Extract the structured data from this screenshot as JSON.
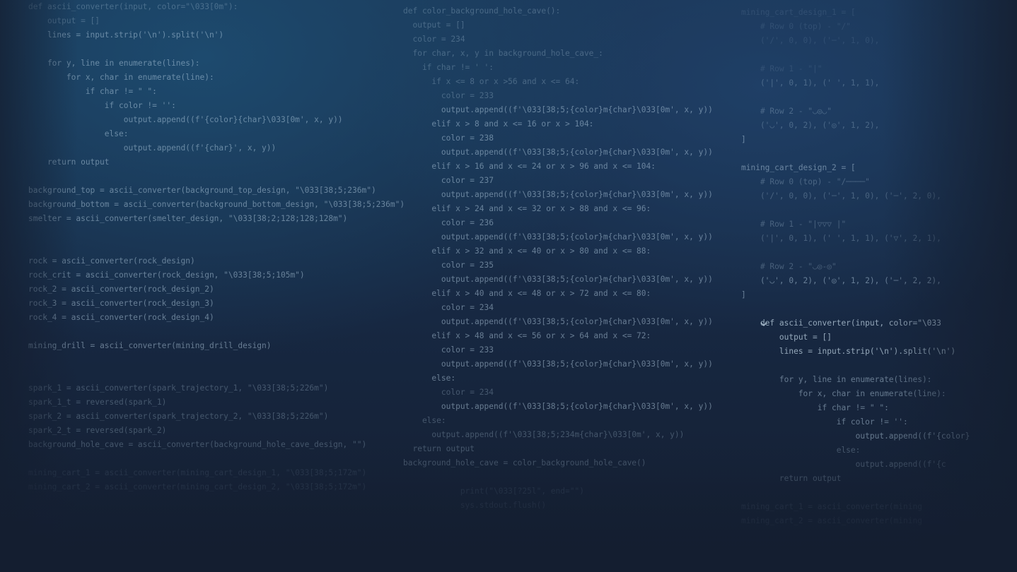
{
  "columns": [
    {
      "id": "left",
      "lines": [
        {
          "t": "def ascii_converter(input, color=\"\\033[0m\"):",
          "o": 1
        },
        {
          "t": "    output = []",
          "o": 1
        },
        {
          "t": "    lines = input.strip('\\n').split('\\n')",
          "o": 2
        },
        {
          "t": "",
          "o": 0
        },
        {
          "t": "    for y, line in enumerate(lines):",
          "o": 2
        },
        {
          "t": "        for x, char in enumerate(line):",
          "o": 2
        },
        {
          "t": "            if char != \" \":",
          "o": 2
        },
        {
          "t": "                if color != '':",
          "o": 2
        },
        {
          "t": "                    output.append((f'{color}{char}\\033[0m', x, y))",
          "o": 2
        },
        {
          "t": "                else:",
          "o": 2
        },
        {
          "t": "                    output.append((f'{char}', x, y))",
          "o": 2
        },
        {
          "t": "    return output",
          "o": 2
        },
        {
          "t": "",
          "o": 0
        },
        {
          "t": "background_top = ascii_converter(background_top_design, \"\\033[38;5;236m\")",
          "o": 2
        },
        {
          "t": "background_bottom = ascii_converter(background_bottom_design, \"\\033[38;5;236m\")",
          "o": 2
        },
        {
          "t": "smelter = ascii_converter(smelter_design, \"\\033[38;2;128;128;128m\")",
          "o": 2
        },
        {
          "t": "",
          "o": 0
        },
        {
          "t": "",
          "o": 0
        },
        {
          "t": "rock = ascii_converter(rock_design)",
          "o": 2
        },
        {
          "t": "rock_crit = ascii_converter(rock_design, \"\\033[38;5;105m\")",
          "o": 2
        },
        {
          "t": "rock_2 = ascii_converter(rock_design_2)",
          "o": 2
        },
        {
          "t": "rock_3 = ascii_converter(rock_design_3)",
          "o": 2
        },
        {
          "t": "rock_4 = ascii_converter(rock_design_4)",
          "o": 2
        },
        {
          "t": "",
          "o": 0
        },
        {
          "t": "mining_drill = ascii_converter(mining_drill_design)",
          "o": 2
        },
        {
          "t": "",
          "o": 0
        },
        {
          "t": "",
          "o": 0
        },
        {
          "t": "spark_1 = ascii_converter(spark_trajectory_1, \"\\033[38;5;226m\")",
          "o": 1
        },
        {
          "t": "spark_1_t = reversed(spark_1)",
          "o": 1
        },
        {
          "t": "spark_2 = ascii_converter(spark_trajectory_2, \"\\033[38;5;226m\")",
          "o": 1
        },
        {
          "t": "spark_2_t = reversed(spark_2)",
          "o": 1
        },
        {
          "t": "background_hole_cave = ascii_converter(background_hole_cave_design, \"\")",
          "o": 1
        },
        {
          "t": "",
          "o": 0
        },
        {
          "t": "mining_cart_1 = ascii_converter(mining_cart_design_1, \"\\033[38;5;172m\")",
          "o": 0
        },
        {
          "t": "mining_cart_2 = ascii_converter(mining_cart_design_2, \"\\033[38;5;172m\")",
          "o": 0
        }
      ]
    },
    {
      "id": "mid",
      "lines": [
        {
          "t": "def color_background_hole_cave():",
          "o": 1
        },
        {
          "t": "  output = []",
          "o": 1
        },
        {
          "t": "  color = 234",
          "o": 1
        },
        {
          "t": "  for char, x, y in background_hole_cave_:",
          "o": 1
        },
        {
          "t": "    if char != ' ':",
          "o": 1
        },
        {
          "t": "      if x <= 8 or x >56 and x <= 64:",
          "o": 1
        },
        {
          "t": "        color = 233",
          "o": 1
        },
        {
          "t": "        output.append((f'\\033[38;5;{color}m{char}\\033[0m', x, y))",
          "o": 2
        },
        {
          "t": "      elif x > 8 and x <= 16 or x > 104:",
          "o": 2
        },
        {
          "t": "        color = 238",
          "o": 2
        },
        {
          "t": "        output.append((f'\\033[38;5;{color}m{char}\\033[0m', x, y))",
          "o": 2
        },
        {
          "t": "      elif x > 16 and x <= 24 or x > 96 and x <= 104:",
          "o": 2
        },
        {
          "t": "        color = 237",
          "o": 2
        },
        {
          "t": "        output.append((f'\\033[38;5;{color}m{char}\\033[0m', x, y))",
          "o": 2
        },
        {
          "t": "      elif x > 24 and x <= 32 or x > 88 and x <= 96:",
          "o": 2
        },
        {
          "t": "        color = 236",
          "o": 2
        },
        {
          "t": "        output.append((f'\\033[38;5;{color}m{char}\\033[0m', x, y))",
          "o": 2
        },
        {
          "t": "      elif x > 32 and x <= 40 or x > 80 and x <= 88:",
          "o": 2
        },
        {
          "t": "        color = 235",
          "o": 2
        },
        {
          "t": "        output.append((f'\\033[38;5;{color}m{char}\\033[0m', x, y))",
          "o": 2
        },
        {
          "t": "      elif x > 40 and x <= 48 or x > 72 and x <= 80:",
          "o": 2
        },
        {
          "t": "        color = 234",
          "o": 2
        },
        {
          "t": "        output.append((f'\\033[38;5;{color}m{char}\\033[0m', x, y))",
          "o": 2
        },
        {
          "t": "      elif x > 48 and x <= 56 or x > 64 and x <= 72:",
          "o": 2
        },
        {
          "t": "        color = 233",
          "o": 2
        },
        {
          "t": "        output.append((f'\\033[38;5;{color}m{char}\\033[0m', x, y))",
          "o": 2
        },
        {
          "t": "      else:",
          "o": 2
        },
        {
          "t": "        color = 234",
          "o": 1
        },
        {
          "t": "        output.append((f'\\033[38;5;{color}m{char}\\033[0m', x, y))",
          "o": 2
        },
        {
          "t": "    else:",
          "o": 1
        },
        {
          "t": "      output.append((f'\\033[38;5;234m{char}\\033[0m', x, y))",
          "o": 1
        },
        {
          "t": "  return output",
          "o": 1
        },
        {
          "t": "background_hole_cave = color_background_hole_cave()",
          "o": 1
        },
        {
          "t": "",
          "o": 0
        },
        {
          "t": "            print(\"\\033[?25l\", end=\"\")",
          "o": 0
        },
        {
          "t": "            sys.stdout.flush()",
          "o": 0
        }
      ]
    },
    {
      "id": "right",
      "lines": [
        {
          "t": "mining_cart_design_1 = [",
          "o": 0
        },
        {
          "t": "    # Row 0 (top) - \"/\"",
          "o": 0
        },
        {
          "t": "    ('/', 0, 0), ('─', 1, 0),",
          "o": 0
        },
        {
          "t": "",
          "o": 0
        },
        {
          "t": "    # Row 1 - \"|\"",
          "o": 0
        },
        {
          "t": "    ('|', 0, 1), (' ', 1, 1),",
          "o": 1
        },
        {
          "t": "",
          "o": 0
        },
        {
          "t": "    # Row 2 - \"◡◎◡\"",
          "o": 1
        },
        {
          "t": "    ('◡', 0, 2), ('◎', 1, 2),",
          "o": 1
        },
        {
          "t": "]",
          "o": 2
        },
        {
          "t": "",
          "o": 0
        },
        {
          "t": "mining_cart_design_2 = [",
          "o": 2
        },
        {
          "t": "    # Row 0 (top) - \"/────\"",
          "o": 1
        },
        {
          "t": "    ('/', 0, 0), ('─', 1, 0), ('─', 2, 0),",
          "o": 1
        },
        {
          "t": "",
          "o": 0
        },
        {
          "t": "    # Row 1 - \"|▽▽▽ |\"",
          "o": 1
        },
        {
          "t": "    ('|', 0, 1), (' ', 1, 1), ('▽', 2, 1),",
          "o": 1
        },
        {
          "t": "",
          "o": 0
        },
        {
          "t": "    # Row 2 - \"◡◎-◎\"",
          "o": 1
        },
        {
          "t": "    ('◡', 0, 2), ('◎', 1, 2), ('─', 2, 2),",
          "o": 2
        },
        {
          "t": "]",
          "o": 2
        },
        {
          "t": "",
          "o": 0
        },
        {
          "t": "    def ascii_converter(input, color=\"\\033",
          "o": 3
        },
        {
          "t": "        output = []",
          "o": 3
        },
        {
          "t": "        lines = input.strip('\\n').split('\\n')",
          "o": 3
        },
        {
          "t": "",
          "o": 0
        },
        {
          "t": "        for y, line in enumerate(lines):",
          "o": 2
        },
        {
          "t": "            for x, char in enumerate(line):",
          "o": 2
        },
        {
          "t": "                if char != \" \":",
          "o": 2
        },
        {
          "t": "                    if color != '':",
          "o": 2
        },
        {
          "t": "                        output.append((f'{color}",
          "o": 2
        },
        {
          "t": "                    else:",
          "o": 1
        },
        {
          "t": "                        output.append((f'{c",
          "o": 1
        },
        {
          "t": "        return output",
          "o": 1
        },
        {
          "t": "",
          "o": 0
        },
        {
          "t": "mining_cart_1 = ascii_converter(mining",
          "o": 0
        },
        {
          "t": "mining_cart_2 = ascii_converter(mining",
          "o": 0
        }
      ]
    }
  ],
  "colors": {
    "background_top": "#1a3554",
    "background_bottom": "#141e30",
    "code_text": "#bed7eb"
  }
}
